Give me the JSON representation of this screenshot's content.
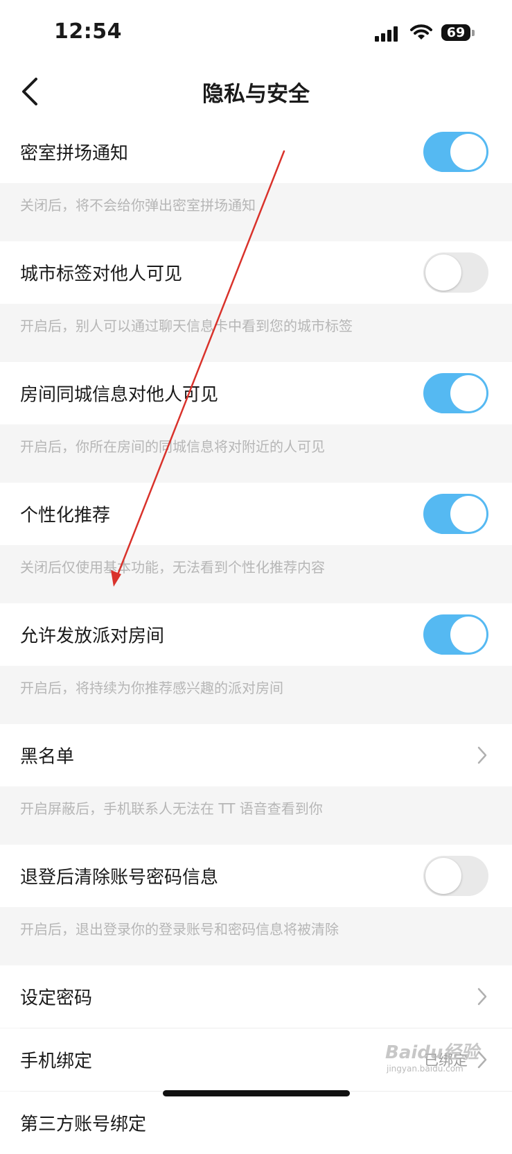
{
  "status_bar": {
    "time": "12:54",
    "battery": "69"
  },
  "nav": {
    "title": "隐私与安全"
  },
  "settings": [
    {
      "label": "密室拼场通知",
      "control": "toggle",
      "state": "on",
      "description": "关闭后，将不会给你弹出密室拼场通知"
    },
    {
      "label": "城市标签对他人可见",
      "control": "toggle",
      "state": "off",
      "description": "开启后，别人可以通过聊天信息卡中看到您的城市标签"
    },
    {
      "label": "房间同城信息对他人可见",
      "control": "toggle",
      "state": "on",
      "description": "开启后，你所在房间的同城信息将对附近的人可见"
    },
    {
      "label": "个性化推荐",
      "control": "toggle",
      "state": "on",
      "description": "关闭后仅使用基本功能，无法看到个性化推荐内容"
    },
    {
      "label": "允许发放派对房间",
      "control": "toggle",
      "state": "on",
      "description": "开启后，将持续为你推荐感兴趣的派对房间"
    },
    {
      "label": "黑名单",
      "control": "chevron",
      "description": "开启屏蔽后，手机联系人无法在 TT 语音查看到你"
    },
    {
      "label": "退登后清除账号密码信息",
      "control": "toggle",
      "state": "off",
      "description": "开启后，退出登录你的登录账号和密码信息将被清除"
    }
  ],
  "account_rows": [
    {
      "label": "设定密码"
    },
    {
      "label": "手机绑定",
      "value": "已绑定"
    },
    {
      "label": "第三方账号绑定"
    }
  ],
  "watermark": {
    "text": "Baidu经验",
    "sub": "jingyan.baidu.com"
  },
  "colors": {
    "toggle_on": "#55b9f2",
    "toggle_off": "#e9e9e9",
    "annotation_arrow": "#d9322b"
  }
}
